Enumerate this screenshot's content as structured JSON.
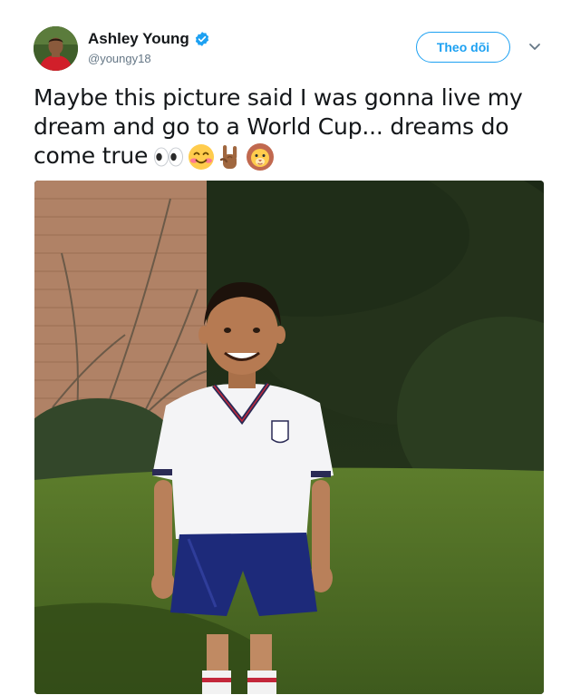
{
  "user": {
    "display_name": "Ashley Young",
    "handle": "@youngy18",
    "verified": true,
    "avatar_icon": "profile-photo"
  },
  "actions": {
    "follow_label": "Theo dõi",
    "more_icon": "chevron-down-icon"
  },
  "tweet": {
    "text": "Maybe this picture said I was gonna live my dream and go to a World Cup... dreams do come true",
    "emojis": [
      "eyes-emoji",
      "smiling-face-emoji",
      "sign-of-horns-emoji",
      "lion-face-emoji"
    ]
  },
  "media": {
    "type": "photo",
    "subject": "child-in-england-kit"
  },
  "colors": {
    "accent": "#1da1f2",
    "text": "#14171a",
    "muted": "#657786"
  }
}
